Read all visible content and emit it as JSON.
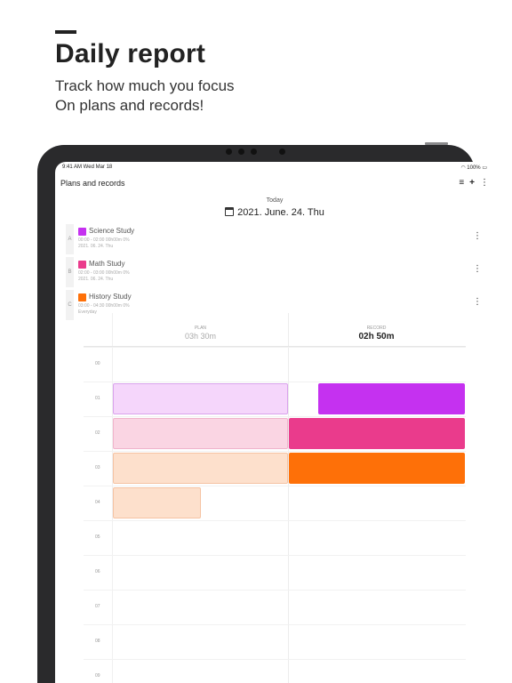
{
  "hero": {
    "title": "Daily report",
    "subtitle_line1": "Track how much you focus",
    "subtitle_line2": "On plans and records!"
  },
  "status_bar": {
    "time": "9:41 AM   Wed Mar 18",
    "battery": "100%"
  },
  "app_bar": {
    "title": "Plans and records",
    "icons": [
      "list-icon",
      "plus-icon",
      "more-vertical-icon"
    ]
  },
  "date_header": {
    "label": "Today",
    "date": "2021. June. 24. Thu"
  },
  "plans": [
    {
      "letter": "A",
      "name": "Science Study",
      "color": "#c531f0",
      "meta1": "00:00 - 02:00 00h00m  0%",
      "meta2": "2021. 06. 24. Thu"
    },
    {
      "letter": "B",
      "name": "Math Study",
      "color": "#ea3b8c",
      "meta1": "02:00 - 03:00 00h00m  0%",
      "meta2": "2021. 06. 24. Thu"
    },
    {
      "letter": "C",
      "name": "History Study",
      "color": "#fe7008",
      "meta1": "03:00 - 04:30 00h00m  0%",
      "meta2": "Everyday"
    }
  ],
  "timetable": {
    "plan_label": "PLAN",
    "plan_total": "03h 30m",
    "record_label": "RECORD",
    "record_total": "02h 50m",
    "hours": [
      "00",
      "01",
      "02",
      "03",
      "04",
      "05",
      "06",
      "07",
      "08",
      "09"
    ],
    "plan_blocks": [
      {
        "color": "#f5d6fb",
        "border": "#d9a2ec"
      },
      {
        "color": "#fad5e3",
        "border": "#f0b3cb"
      },
      {
        "color": "#fde0cc",
        "border": "#f5c3a3"
      },
      {
        "color": "#fde0cc",
        "border": "#f5c3a3"
      }
    ],
    "record_blocks": [
      {
        "color": "#c531f0"
      },
      {
        "color": "#ea3b8c"
      },
      {
        "color": "#fe7008"
      }
    ]
  }
}
